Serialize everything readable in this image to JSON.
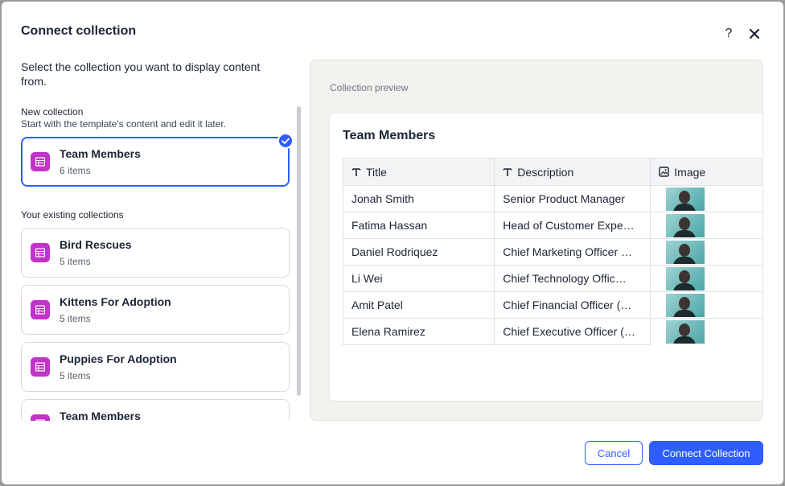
{
  "dialog": {
    "title": "Connect collection",
    "help_label": "?",
    "intro": "Select the collection you want to display content from.",
    "new_collection_label": "New collection",
    "new_collection_sub": "Start with the template's content and edit it later.",
    "existing_label": "Your existing collections",
    "cancel_label": "Cancel",
    "connect_label": "Connect Collection"
  },
  "new_collection": {
    "name": "Team Members",
    "count": "6 items",
    "selected": true
  },
  "existing_collections": [
    {
      "name": "Bird Rescues",
      "count": "5 items"
    },
    {
      "name": "Kittens For Adoption",
      "count": "5 items"
    },
    {
      "name": "Puppies For Adoption",
      "count": "5 items"
    },
    {
      "name": "Team Members",
      "count": ""
    }
  ],
  "preview": {
    "label": "Collection preview",
    "title": "Team Members",
    "columns": [
      "Title",
      "Description",
      "Image"
    ],
    "rows": [
      {
        "title": "Jonah Smith",
        "description": "Senior Product Manager"
      },
      {
        "title": "Fatima Hassan",
        "description": "Head of Customer Expe…"
      },
      {
        "title": "Daniel Rodriquez",
        "description": "Chief Marketing Officer …"
      },
      {
        "title": "Li Wei",
        "description": "Chief Technology Offic…"
      },
      {
        "title": "Amit Patel",
        "description": "Chief Financial Officer (…"
      },
      {
        "title": "Elena Ramirez",
        "description": "Chief Executive Officer (…"
      }
    ]
  },
  "colors": {
    "accent": "#2f5dff",
    "collection_icon": "#c233c9",
    "preview_bg": "#f4f2ee"
  },
  "icons": [
    "close-icon",
    "collection-table-icon",
    "checkmark-icon",
    "text-field-icon",
    "image-field-icon"
  ]
}
